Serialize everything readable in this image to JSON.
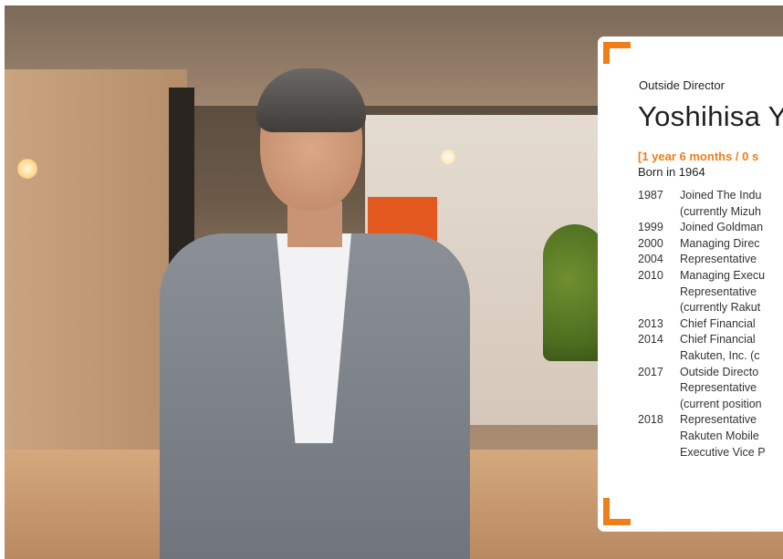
{
  "card": {
    "role": "Outside Director",
    "name": "Yoshihisa Y",
    "tenure": "[1 year 6 months / 0 s",
    "born": "Born in 1964",
    "history": [
      {
        "year": "1987",
        "lines": [
          "Joined The Indu",
          "(currently Mizuh"
        ]
      },
      {
        "year": "1999",
        "lines": [
          "Joined Goldman"
        ]
      },
      {
        "year": "2000",
        "lines": [
          "Managing Direc"
        ]
      },
      {
        "year": "2004",
        "lines": [
          "Representative"
        ]
      },
      {
        "year": "2010",
        "lines": [
          "Managing Execu",
          "Representative",
          "(currently Rakut"
        ]
      },
      {
        "year": "2013",
        "lines": [
          "Chief Financial"
        ]
      },
      {
        "year": "2014",
        "lines": [
          "Chief Financial",
          "Rakuten, Inc. (c"
        ]
      },
      {
        "year": "2017",
        "lines": [
          "Outside Directo",
          "Representative",
          "(current position"
        ]
      },
      {
        "year": "2018",
        "lines": [
          "Representative",
          "Rakuten Mobile",
          "Executive Vice P"
        ]
      }
    ]
  },
  "colors": {
    "accent": "#ef7d1a",
    "text": "#1f1f1f"
  }
}
